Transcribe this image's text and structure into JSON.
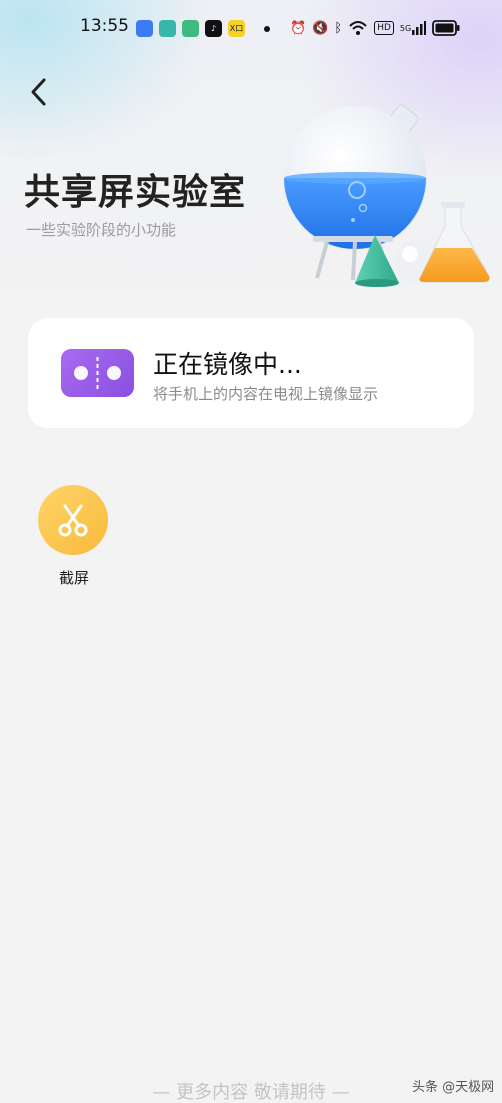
{
  "status_bar": {
    "time": "13:55",
    "app_badge_text": "X口",
    "hd_label": "HD",
    "net_label": "5G"
  },
  "header": {
    "title": "共享屏实验室",
    "subtitle": "一些实验阶段的小功能"
  },
  "mirror_card": {
    "title": "正在镜像中...",
    "description": "将手机上的内容在电视上镜像显示"
  },
  "tools": [
    {
      "label": "截屏",
      "icon": "scissors-icon"
    }
  ],
  "footer": {
    "text": "— 更多内容  敬请期待 —"
  },
  "watermark": "头条 @天极网",
  "colors": {
    "mirror_icon": "#9b5cf0",
    "tool_icon": "#fbc44f",
    "flask_liquid": "#2f87f5"
  }
}
